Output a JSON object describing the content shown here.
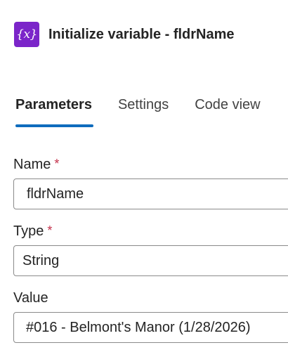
{
  "header": {
    "icon": "variable-icon",
    "icon_glyph": "{x}",
    "accent_color": "#7b25c9",
    "title": "Initialize variable - fldrName"
  },
  "tabs": [
    {
      "label": "Parameters",
      "active": true
    },
    {
      "label": "Settings",
      "active": false
    },
    {
      "label": "Code view",
      "active": false
    }
  ],
  "fields": {
    "name": {
      "label": "Name",
      "required": "*",
      "value": "fldrName"
    },
    "type": {
      "label": "Type",
      "required": "*",
      "value": "String"
    },
    "value": {
      "label": "Value",
      "value": "#016 - Belmont's Manor (1/28/2026)"
    }
  }
}
